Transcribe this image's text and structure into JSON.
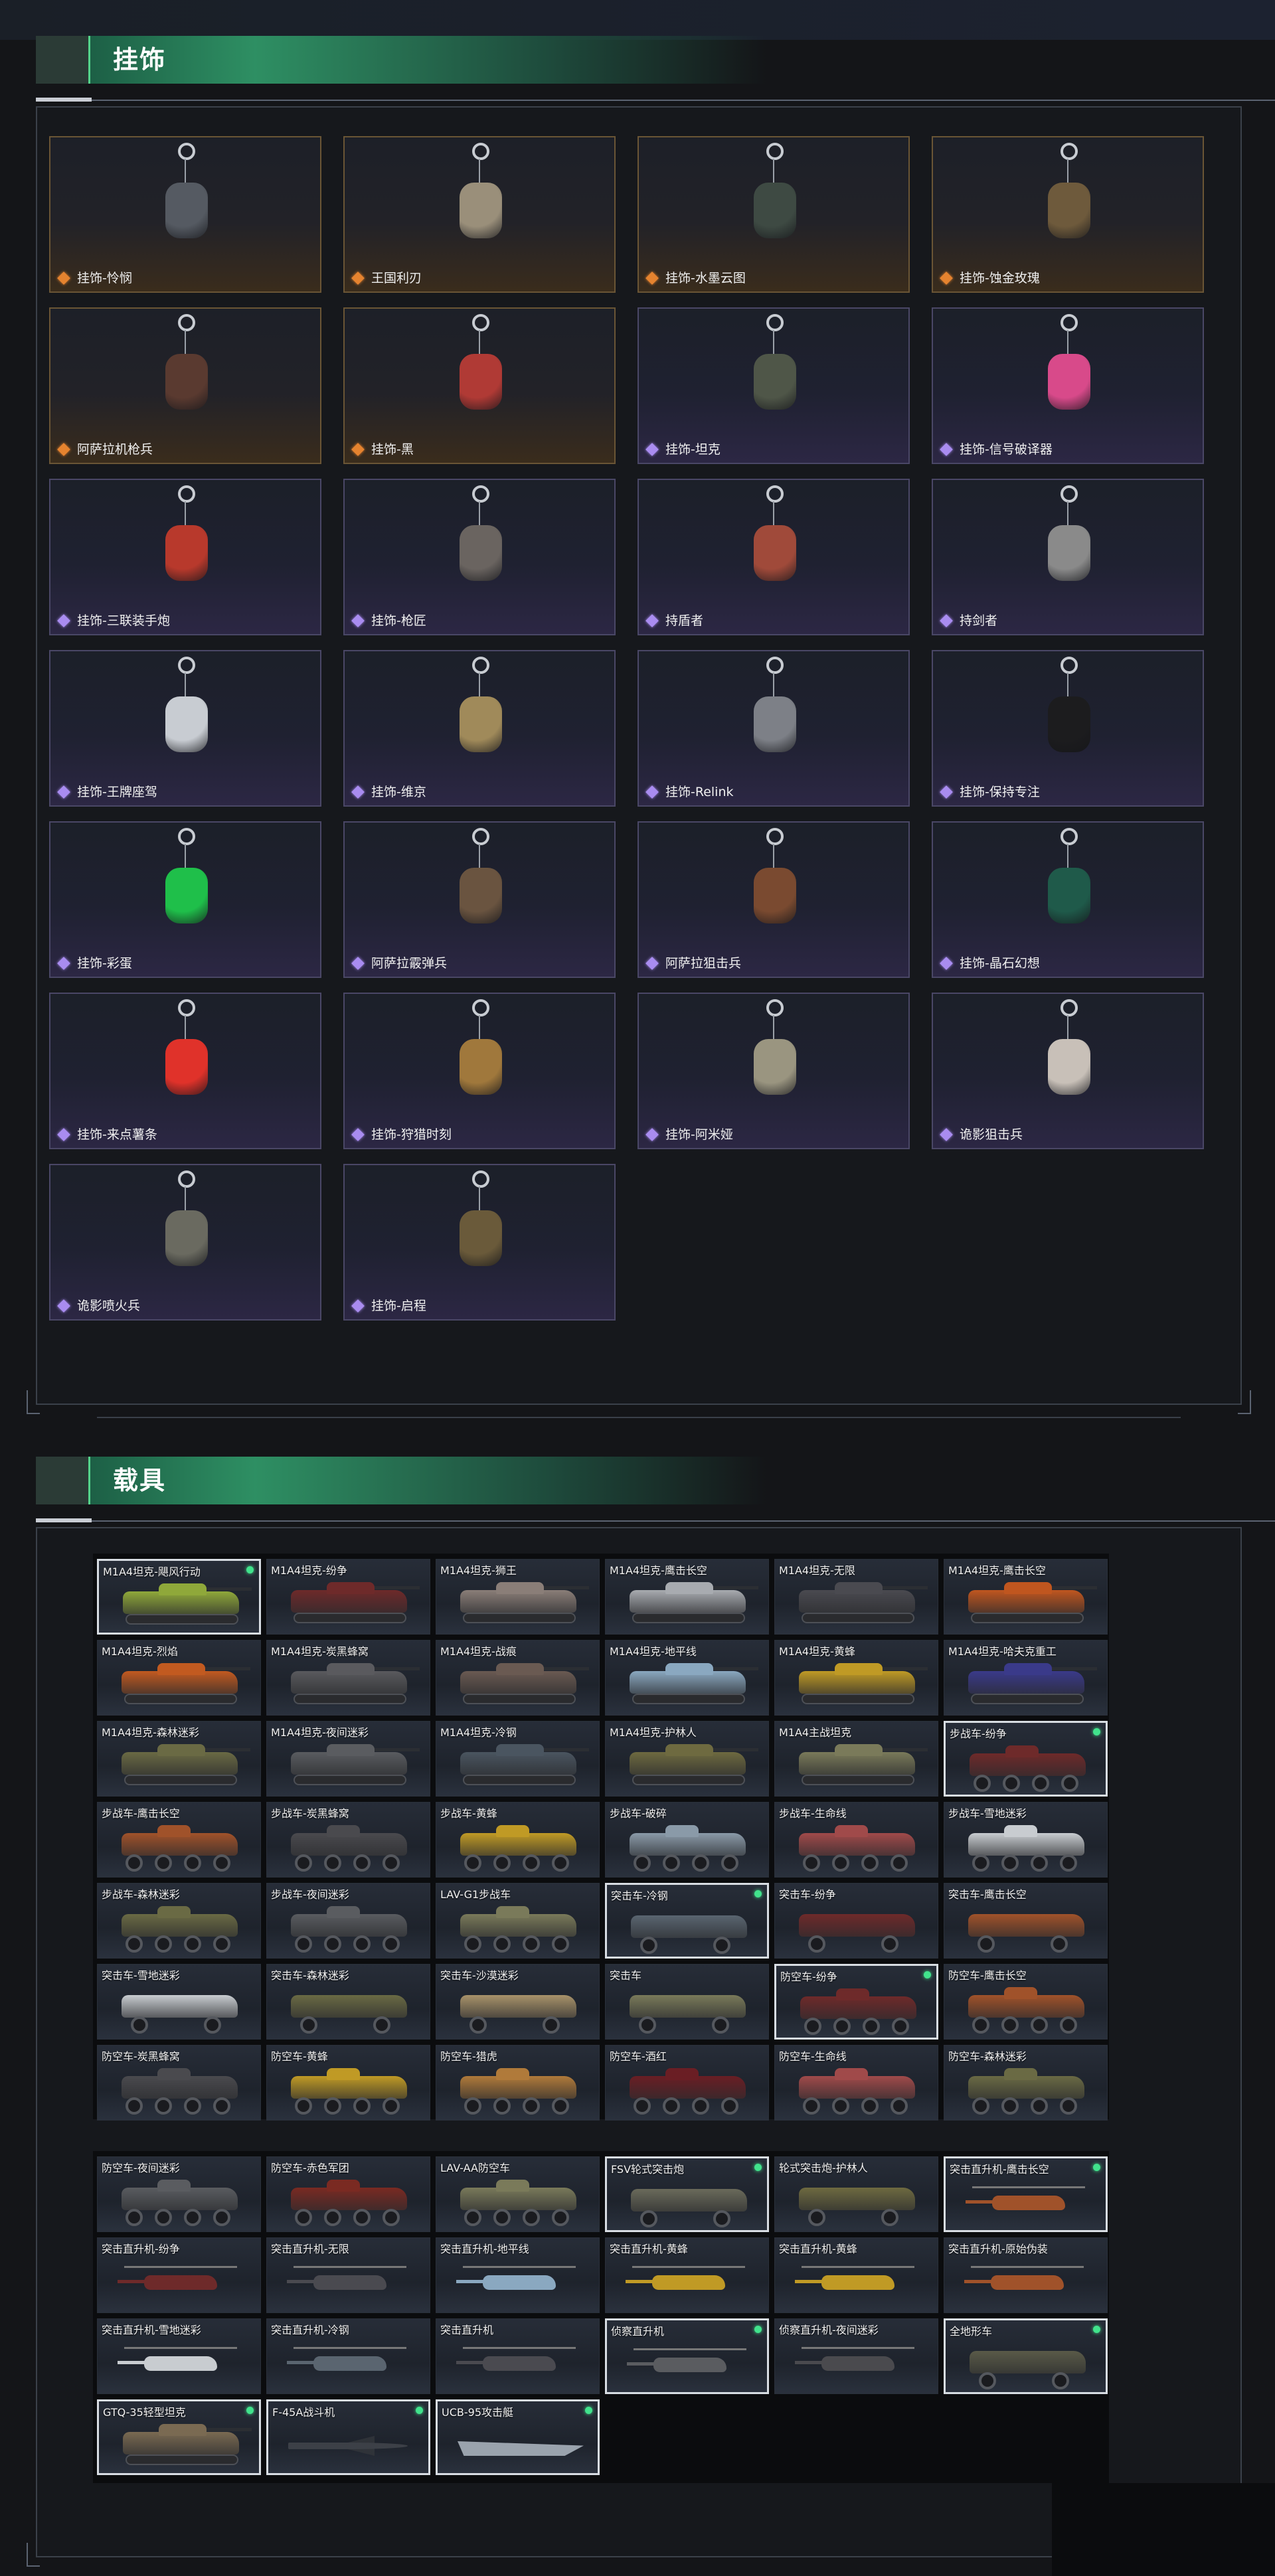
{
  "charms_section": {
    "title": "挂饰",
    "items": [
      {
        "label": "挂饰-怜悯",
        "tier": "gold",
        "color": "#555a62"
      },
      {
        "label": "王国利刃",
        "tier": "gold",
        "color": "#9a8f7a"
      },
      {
        "label": "挂饰-水墨云图",
        "tier": "gold",
        "color": "#3e4a43"
      },
      {
        "label": "挂饰-蚀金玫瑰",
        "tier": "gold",
        "color": "#6e5a3c"
      },
      {
        "label": "阿萨拉机枪兵",
        "tier": "gold",
        "color": "#5a3a30"
      },
      {
        "label": "挂饰-黑",
        "tier": "gold",
        "color": "#b03a35"
      },
      {
        "label": "挂饰-坦克",
        "tier": "purple",
        "color": "#4f5648"
      },
      {
        "label": "挂饰-信号破译器",
        "tier": "purple",
        "color": "#d84a8a"
      },
      {
        "label": "挂饰-三联装手炮",
        "tier": "purple",
        "color": "#b8392c"
      },
      {
        "label": "挂饰-枪匠",
        "tier": "purple",
        "color": "#6a6460"
      },
      {
        "label": "持盾者",
        "tier": "purple",
        "color": "#a04a3a"
      },
      {
        "label": "持剑者",
        "tier": "purple",
        "color": "#8a8a8a"
      },
      {
        "label": "挂饰-王牌座驾",
        "tier": "purple",
        "color": "#c8ccd2"
      },
      {
        "label": "挂饰-维京",
        "tier": "purple",
        "color": "#a08a5a"
      },
      {
        "label": "挂饰-Relink",
        "tier": "purple",
        "color": "#7d8087"
      },
      {
        "label": "挂饰-保持专注",
        "tier": "purple",
        "color": "#1c1c1e"
      },
      {
        "label": "挂饰-彩蛋",
        "tier": "purple",
        "color": "#1fbf4a"
      },
      {
        "label": "阿萨拉霰弹兵",
        "tier": "purple",
        "color": "#6a5440"
      },
      {
        "label": "阿萨拉狙击兵",
        "tier": "purple",
        "color": "#7a4a30"
      },
      {
        "label": "挂饰-晶石幻想",
        "tier": "purple",
        "color": "#1f5a4a"
      },
      {
        "label": "挂饰-来点薯条",
        "tier": "purple",
        "color": "#e0322a"
      },
      {
        "label": "挂饰-狩猎时刻",
        "tier": "purple",
        "color": "#a0783c"
      },
      {
        "label": "挂饰-阿米娅",
        "tier": "purple",
        "color": "#9a9580"
      },
      {
        "label": "诡影狙击兵",
        "tier": "purple",
        "color": "#c8c0b8"
      },
      {
        "label": "诡影喷火兵",
        "tier": "purple",
        "color": "#6a6a60"
      },
      {
        "label": "挂饰-启程",
        "tier": "purple",
        "color": "#6a5a3a"
      }
    ]
  },
  "vehicles_section": {
    "title": "载具",
    "group1": [
      {
        "label": "M1A4坦克-飓风行动",
        "kind": "tank",
        "color": "#8fa83a",
        "hl": true,
        "dot": true
      },
      {
        "label": "M1A4坦克-纷争",
        "kind": "tank",
        "color": "#6e2a2a"
      },
      {
        "label": "M1A4坦克-狮王",
        "kind": "tank",
        "color": "#8a7e78"
      },
      {
        "label": "M1A4坦克-鹰击长空",
        "kind": "tank",
        "color": "#a8abb0"
      },
      {
        "label": "M1A4坦克-无限",
        "kind": "tank",
        "color": "#4a4a50"
      },
      {
        "label": "M1A4坦克-鹰击长空",
        "kind": "tank",
        "color": "#c0561f"
      },
      {
        "label": "M1A4坦克-烈焰",
        "kind": "tank",
        "color": "#c25a20"
      },
      {
        "label": "M1A4坦克-炭黑蜂窝",
        "kind": "tank",
        "color": "#5a5a5e"
      },
      {
        "label": "M1A4坦克-战痕",
        "kind": "tank",
        "color": "#6a5a52"
      },
      {
        "label": "M1A4坦克-地平线",
        "kind": "tank",
        "color": "#8aa8c0"
      },
      {
        "label": "M1A4坦克-黄蜂",
        "kind": "tank",
        "color": "#c09a25"
      },
      {
        "label": "M1A4坦克-哈夫克重工",
        "kind": "tank",
        "color": "#3a3a8a"
      },
      {
        "label": "M1A4坦克-森林迷彩",
        "kind": "tank",
        "color": "#6a6a44"
      },
      {
        "label": "M1A4坦克-夜间迷彩",
        "kind": "tank",
        "color": "#5a5c60"
      },
      {
        "label": "M1A4坦克-冷钢",
        "kind": "tank",
        "color": "#4a5560"
      },
      {
        "label": "M1A4坦克-护林人",
        "kind": "tank",
        "color": "#6e6a40"
      },
      {
        "label": "M1A4主战坦克",
        "kind": "tank",
        "color": "#7a7a5a"
      },
      {
        "label": "步战车-纷争",
        "kind": "apc",
        "color": "#6e2a2a",
        "hl": true,
        "dot": true
      },
      {
        "label": "步战车-鹰击长空",
        "kind": "apc",
        "color": "#a0522a"
      },
      {
        "label": "步战车-炭黑蜂窝",
        "kind": "apc",
        "color": "#4a4a4e"
      },
      {
        "label": "步战车-黄蜂",
        "kind": "apc",
        "color": "#c09a25"
      },
      {
        "label": "步战车-破碎",
        "kind": "apc",
        "color": "#8a9aa8"
      },
      {
        "label": "步战车-生命线",
        "kind": "apc",
        "color": "#a04a4a"
      },
      {
        "label": "步战车-雪地迷彩",
        "kind": "apc",
        "color": "#c8ccd0"
      },
      {
        "label": "步战车-森林迷彩",
        "kind": "apc",
        "color": "#6a6a44"
      },
      {
        "label": "步战车-夜间迷彩",
        "kind": "apc",
        "color": "#5a5c60"
      },
      {
        "label": "LAV-G1步战车",
        "kind": "apc",
        "color": "#7a7a5a"
      },
      {
        "label": "突击车-冷钢",
        "kind": "car",
        "color": "#5a6570",
        "hl": true,
        "dot": true
      },
      {
        "label": "突击车-纷争",
        "kind": "car",
        "color": "#6e2a2a"
      },
      {
        "label": "突击车-鹰击长空",
        "kind": "car",
        "color": "#a0522a"
      },
      {
        "label": "突击车-雪地迷彩",
        "kind": "car",
        "color": "#c8ccd0"
      },
      {
        "label": "突击车-森林迷彩",
        "kind": "car",
        "color": "#6a6a44"
      },
      {
        "label": "突击车-沙漠迷彩",
        "kind": "car",
        "color": "#a8926a"
      },
      {
        "label": "突击车",
        "kind": "car",
        "color": "#7a7a5a"
      },
      {
        "label": "防空车-纷争",
        "kind": "apc",
        "color": "#6e2a2a",
        "hl": true,
        "dot": true
      },
      {
        "label": "防空车-鹰击长空",
        "kind": "apc",
        "color": "#a0522a"
      },
      {
        "label": "防空车-炭黑蜂窝",
        "kind": "apc",
        "color": "#4a4a4e"
      },
      {
        "label": "防空车-黄蜂",
        "kind": "apc",
        "color": "#c09a25"
      },
      {
        "label": "防空车-猎虎",
        "kind": "apc",
        "color": "#b07a3a"
      },
      {
        "label": "防空车-酒红",
        "kind": "apc",
        "color": "#6a1e24"
      },
      {
        "label": "防空车-生命线",
        "kind": "apc",
        "color": "#a04a4a"
      },
      {
        "label": "防空车-森林迷彩",
        "kind": "apc",
        "color": "#6a6a44"
      }
    ],
    "group2": [
      {
        "label": "防空车-夜间迷彩",
        "kind": "apc",
        "color": "#5a5c60"
      },
      {
        "label": "防空车-赤色军团",
        "kind": "apc",
        "color": "#7a2a22"
      },
      {
        "label": "LAV-AA防空车",
        "kind": "apc",
        "color": "#7a7a5a"
      },
      {
        "label": "FSV轮式突击炮",
        "kind": "car",
        "color": "#6a6a5a",
        "hl": true,
        "dot": true
      },
      {
        "label": "轮式突击炮-护林人",
        "kind": "car",
        "color": "#6e6a40"
      },
      {
        "label": "突击直升机-鹰击长空",
        "kind": "heli",
        "color": "#a0522a",
        "hl": true,
        "dot": true
      },
      {
        "label": "突击直升机-纷争",
        "kind": "heli",
        "color": "#6e2a2a"
      },
      {
        "label": "突击直升机-无限",
        "kind": "heli",
        "color": "#4a4a50"
      },
      {
        "label": "突击直升机-地平线",
        "kind": "heli",
        "color": "#8aa8c0"
      },
      {
        "label": "突击直升机-黄蜂",
        "kind": "heli",
        "color": "#c09a25"
      },
      {
        "label": "突击直升机-黄蜂",
        "kind": "heli",
        "color": "#c09a25"
      },
      {
        "label": "突击直升机-原始伪装",
        "kind": "heli",
        "color": "#a0522a"
      },
      {
        "label": "突击直升机-雪地迷彩",
        "kind": "heli",
        "color": "#c8ccd0"
      },
      {
        "label": "突击直升机-冷钢",
        "kind": "heli",
        "color": "#5a6570"
      },
      {
        "label": "突击直升机",
        "kind": "heli",
        "color": "#4a4a50"
      },
      {
        "label": "侦察直升机",
        "kind": "heli",
        "color": "#5a5c60",
        "hl": true,
        "dot": true
      },
      {
        "label": "侦察直升机-夜间迷彩",
        "kind": "heli",
        "color": "#4a4a4e"
      },
      {
        "label": "全地形车",
        "kind": "car",
        "color": "#5a5a48",
        "hl": true,
        "dot": true
      },
      {
        "label": "GTQ-35轻型坦克",
        "kind": "tank",
        "color": "#7a6a52",
        "hl": true,
        "dot": true
      },
      {
        "label": "F-45A战斗机",
        "kind": "jet",
        "color": "#3c4047",
        "hl": true,
        "dot": true
      },
      {
        "label": "UCB-95攻击艇",
        "kind": "boat",
        "color": "#9aa3ad",
        "hl": true,
        "dot": true
      }
    ]
  }
}
